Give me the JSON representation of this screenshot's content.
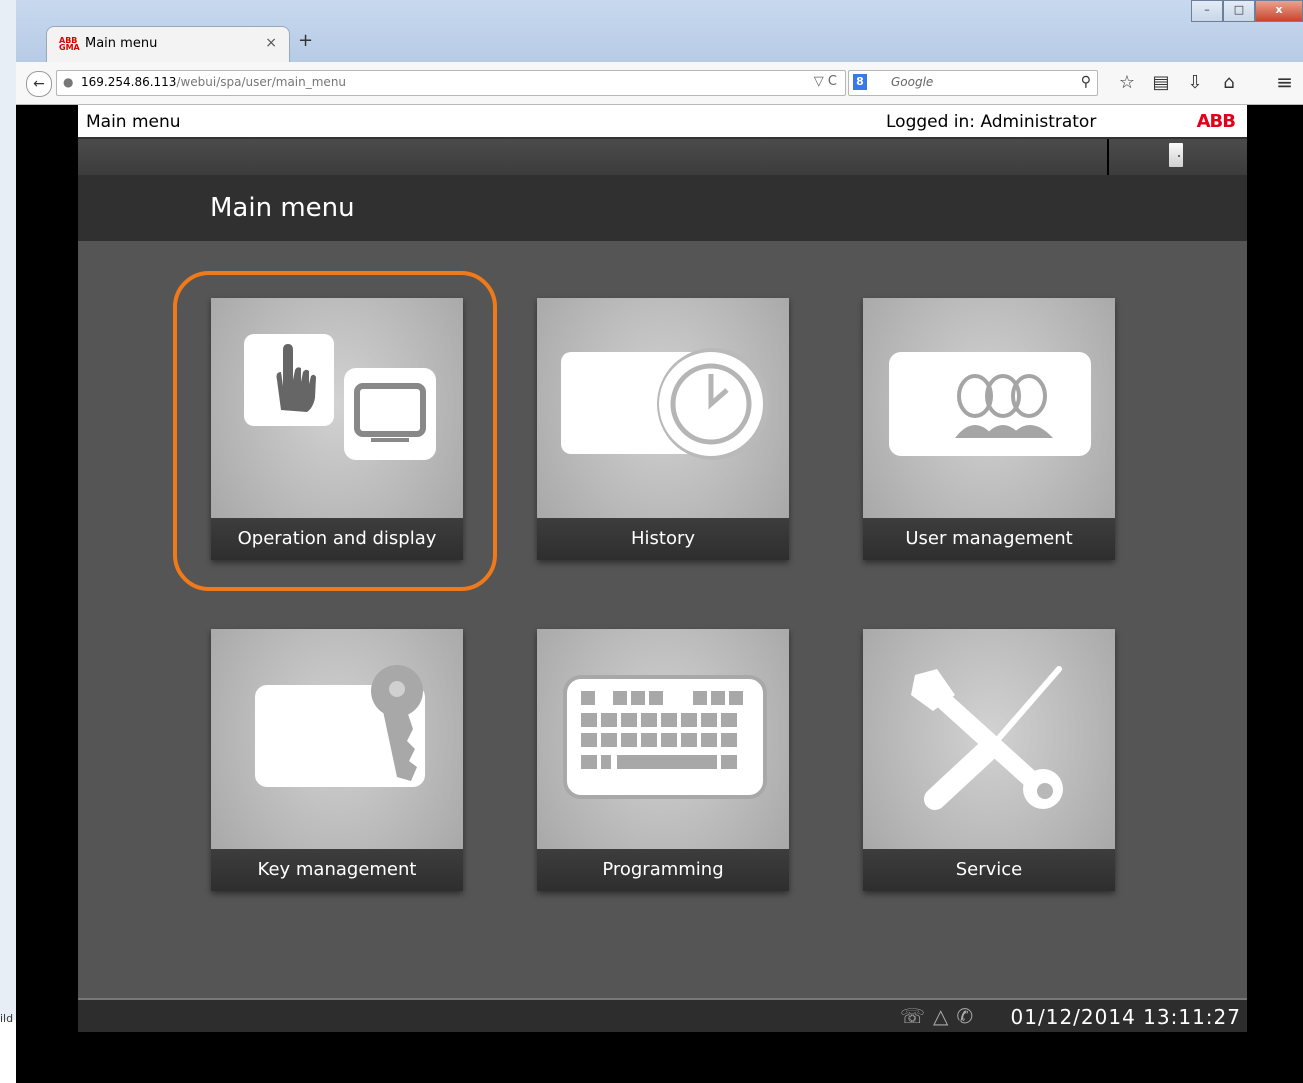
{
  "browser": {
    "tab_title": "Main menu",
    "tab_close": "×",
    "new_tab": "+",
    "url_host": "169.254.86.113",
    "url_path": "/webui/spa/user/main_menu",
    "search_placeholder": "Google",
    "window_buttons": [
      "–",
      "□",
      "x"
    ]
  },
  "app": {
    "top_title": "Main menu",
    "logged_in": "Logged in: Administrator",
    "brand": "ABB",
    "page_title": "Main menu",
    "datetime": "01/12/2014 13:11:27"
  },
  "tiles": [
    {
      "label": "Operation and display",
      "icon": "operation-display-icon"
    },
    {
      "label": "History",
      "icon": "history-clock-icon"
    },
    {
      "label": "User management",
      "icon": "users-icon"
    },
    {
      "label": "Key management",
      "icon": "key-icon"
    },
    {
      "label": "Programming",
      "icon": "keyboard-icon"
    },
    {
      "label": "Service",
      "icon": "tools-icon"
    }
  ],
  "highlight_color": "#f07a1a",
  "stray_text": "ild"
}
